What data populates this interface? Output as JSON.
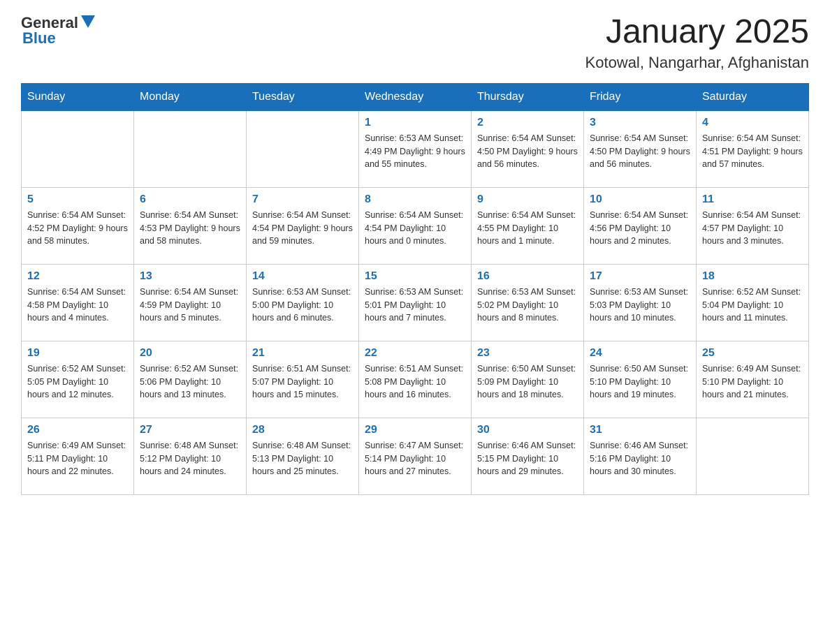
{
  "header": {
    "logo_general": "General",
    "logo_blue": "Blue",
    "month_title": "January 2025",
    "location": "Kotowal, Nangarhar, Afghanistan"
  },
  "days_of_week": [
    "Sunday",
    "Monday",
    "Tuesday",
    "Wednesday",
    "Thursday",
    "Friday",
    "Saturday"
  ],
  "weeks": [
    [
      {
        "day": "",
        "info": ""
      },
      {
        "day": "",
        "info": ""
      },
      {
        "day": "",
        "info": ""
      },
      {
        "day": "1",
        "info": "Sunrise: 6:53 AM\nSunset: 4:49 PM\nDaylight: 9 hours\nand 55 minutes."
      },
      {
        "day": "2",
        "info": "Sunrise: 6:54 AM\nSunset: 4:50 PM\nDaylight: 9 hours\nand 56 minutes."
      },
      {
        "day": "3",
        "info": "Sunrise: 6:54 AM\nSunset: 4:50 PM\nDaylight: 9 hours\nand 56 minutes."
      },
      {
        "day": "4",
        "info": "Sunrise: 6:54 AM\nSunset: 4:51 PM\nDaylight: 9 hours\nand 57 minutes."
      }
    ],
    [
      {
        "day": "5",
        "info": "Sunrise: 6:54 AM\nSunset: 4:52 PM\nDaylight: 9 hours\nand 58 minutes."
      },
      {
        "day": "6",
        "info": "Sunrise: 6:54 AM\nSunset: 4:53 PM\nDaylight: 9 hours\nand 58 minutes."
      },
      {
        "day": "7",
        "info": "Sunrise: 6:54 AM\nSunset: 4:54 PM\nDaylight: 9 hours\nand 59 minutes."
      },
      {
        "day": "8",
        "info": "Sunrise: 6:54 AM\nSunset: 4:54 PM\nDaylight: 10 hours\nand 0 minutes."
      },
      {
        "day": "9",
        "info": "Sunrise: 6:54 AM\nSunset: 4:55 PM\nDaylight: 10 hours\nand 1 minute."
      },
      {
        "day": "10",
        "info": "Sunrise: 6:54 AM\nSunset: 4:56 PM\nDaylight: 10 hours\nand 2 minutes."
      },
      {
        "day": "11",
        "info": "Sunrise: 6:54 AM\nSunset: 4:57 PM\nDaylight: 10 hours\nand 3 minutes."
      }
    ],
    [
      {
        "day": "12",
        "info": "Sunrise: 6:54 AM\nSunset: 4:58 PM\nDaylight: 10 hours\nand 4 minutes."
      },
      {
        "day": "13",
        "info": "Sunrise: 6:54 AM\nSunset: 4:59 PM\nDaylight: 10 hours\nand 5 minutes."
      },
      {
        "day": "14",
        "info": "Sunrise: 6:53 AM\nSunset: 5:00 PM\nDaylight: 10 hours\nand 6 minutes."
      },
      {
        "day": "15",
        "info": "Sunrise: 6:53 AM\nSunset: 5:01 PM\nDaylight: 10 hours\nand 7 minutes."
      },
      {
        "day": "16",
        "info": "Sunrise: 6:53 AM\nSunset: 5:02 PM\nDaylight: 10 hours\nand 8 minutes."
      },
      {
        "day": "17",
        "info": "Sunrise: 6:53 AM\nSunset: 5:03 PM\nDaylight: 10 hours\nand 10 minutes."
      },
      {
        "day": "18",
        "info": "Sunrise: 6:52 AM\nSunset: 5:04 PM\nDaylight: 10 hours\nand 11 minutes."
      }
    ],
    [
      {
        "day": "19",
        "info": "Sunrise: 6:52 AM\nSunset: 5:05 PM\nDaylight: 10 hours\nand 12 minutes."
      },
      {
        "day": "20",
        "info": "Sunrise: 6:52 AM\nSunset: 5:06 PM\nDaylight: 10 hours\nand 13 minutes."
      },
      {
        "day": "21",
        "info": "Sunrise: 6:51 AM\nSunset: 5:07 PM\nDaylight: 10 hours\nand 15 minutes."
      },
      {
        "day": "22",
        "info": "Sunrise: 6:51 AM\nSunset: 5:08 PM\nDaylight: 10 hours\nand 16 minutes."
      },
      {
        "day": "23",
        "info": "Sunrise: 6:50 AM\nSunset: 5:09 PM\nDaylight: 10 hours\nand 18 minutes."
      },
      {
        "day": "24",
        "info": "Sunrise: 6:50 AM\nSunset: 5:10 PM\nDaylight: 10 hours\nand 19 minutes."
      },
      {
        "day": "25",
        "info": "Sunrise: 6:49 AM\nSunset: 5:10 PM\nDaylight: 10 hours\nand 21 minutes."
      }
    ],
    [
      {
        "day": "26",
        "info": "Sunrise: 6:49 AM\nSunset: 5:11 PM\nDaylight: 10 hours\nand 22 minutes."
      },
      {
        "day": "27",
        "info": "Sunrise: 6:48 AM\nSunset: 5:12 PM\nDaylight: 10 hours\nand 24 minutes."
      },
      {
        "day": "28",
        "info": "Sunrise: 6:48 AM\nSunset: 5:13 PM\nDaylight: 10 hours\nand 25 minutes."
      },
      {
        "day": "29",
        "info": "Sunrise: 6:47 AM\nSunset: 5:14 PM\nDaylight: 10 hours\nand 27 minutes."
      },
      {
        "day": "30",
        "info": "Sunrise: 6:46 AM\nSunset: 5:15 PM\nDaylight: 10 hours\nand 29 minutes."
      },
      {
        "day": "31",
        "info": "Sunrise: 6:46 AM\nSunset: 5:16 PM\nDaylight: 10 hours\nand 30 minutes."
      },
      {
        "day": "",
        "info": ""
      }
    ]
  ]
}
